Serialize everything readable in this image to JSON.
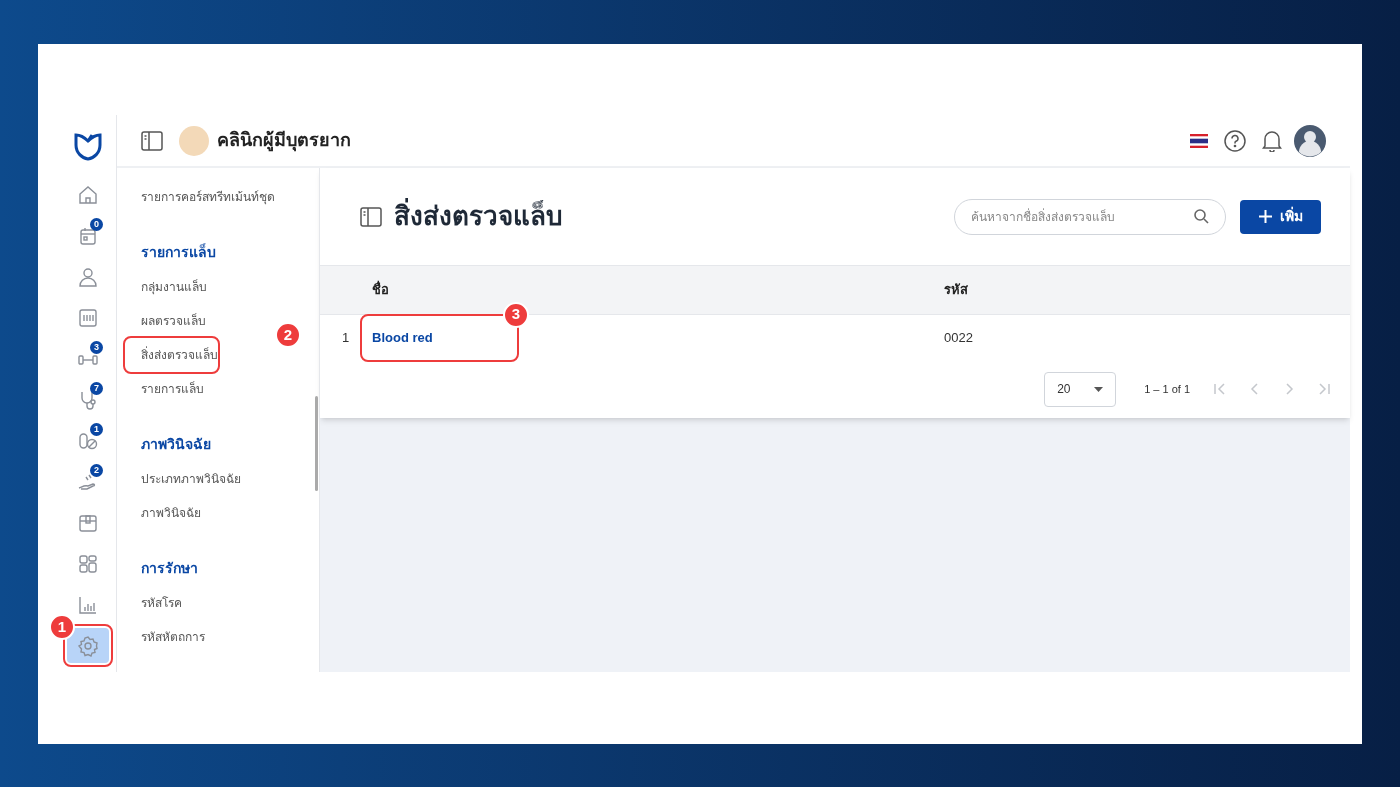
{
  "app": {
    "title": "คลินิกผู้มีบุตรยาก"
  },
  "rail": [
    {
      "kind": "home",
      "selected": false
    },
    {
      "kind": "calendar",
      "badge": "0",
      "selected": false
    },
    {
      "kind": "person",
      "selected": false
    },
    {
      "kind": "scanner",
      "selected": false
    },
    {
      "kind": "dumbbell",
      "badge": "3",
      "selected": false
    },
    {
      "kind": "stethoscope",
      "badge": "7",
      "selected": false
    },
    {
      "kind": "pills",
      "badge": "1",
      "selected": false
    },
    {
      "kind": "hand",
      "badge": "2",
      "selected": false
    },
    {
      "kind": "box",
      "selected": false
    },
    {
      "kind": "grid",
      "selected": false
    },
    {
      "kind": "chart",
      "selected": false
    },
    {
      "kind": "settings",
      "selected": true,
      "callout": "1"
    }
  ],
  "submenu": [
    {
      "kind": "item",
      "label": "รายการคอร์สทรีทเม้นท์ชุด"
    },
    {
      "kind": "heading",
      "label": "รายการแล็บ"
    },
    {
      "kind": "item",
      "label": "กลุ่มงานแล็บ"
    },
    {
      "kind": "item",
      "label": "ผลตรวจแล็บ"
    },
    {
      "kind": "item",
      "label": "สิ่งส่งตรวจแล็บ",
      "callout": "2"
    },
    {
      "kind": "item",
      "label": "รายการแล็บ"
    },
    {
      "kind": "heading",
      "label": "ภาพวินิจฉัย"
    },
    {
      "kind": "item",
      "label": "ประเภทภาพวินิจฉัย"
    },
    {
      "kind": "item",
      "label": "ภาพวินิจฉัย"
    },
    {
      "kind": "heading",
      "label": "การรักษา"
    },
    {
      "kind": "item",
      "label": "รหัสโรค"
    },
    {
      "kind": "item",
      "label": "รหัสหัตถการ"
    }
  ],
  "page": {
    "title": "สิ่งส่งตรวจแล็บ",
    "search_placeholder": "ค้นหาจากชื่อสิ่งส่งตรวจแล็บ",
    "add_button": "เพิ่ม"
  },
  "table": {
    "columns": [
      "ชื่อ",
      "รหัส"
    ],
    "rows": [
      {
        "index": "1",
        "name": "Blood red",
        "code": "0022",
        "callout": "3"
      }
    ]
  },
  "pagination": {
    "page_size": "20",
    "range": "1 – 1 of 1"
  }
}
